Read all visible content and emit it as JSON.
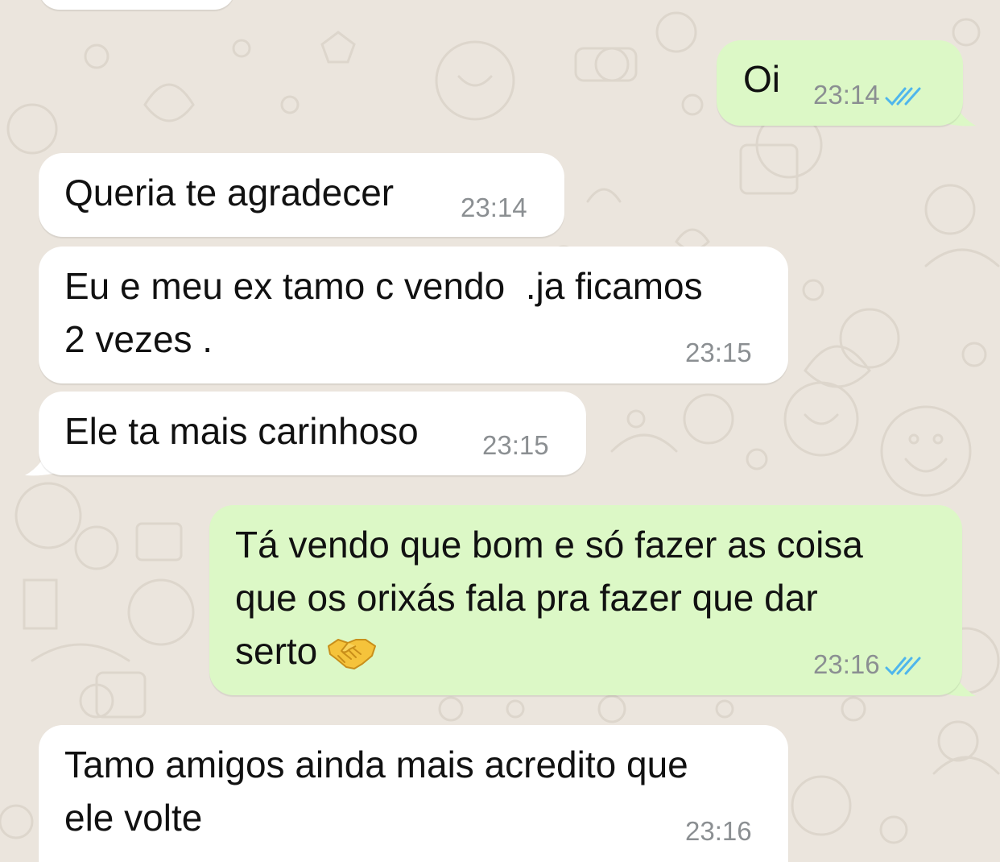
{
  "chat": {
    "accent_read_ticks": "#4fb6ec",
    "incoming_color": "#ffffff",
    "outgoing_color": "#dcf8c6",
    "messages": [
      {
        "direction": "outgoing",
        "text": "Oi",
        "time": "23:14",
        "status": "read"
      },
      {
        "direction": "incoming",
        "text": "Queria te agradecer",
        "time": "23:14"
      },
      {
        "direction": "incoming",
        "text_lines": [
          "Eu e meu ex tamo c vendo  .ja ficamos",
          "2 vezes ."
        ],
        "time": "23:15"
      },
      {
        "direction": "incoming",
        "text": "Ele ta mais carinhoso",
        "time": "23:15"
      },
      {
        "direction": "outgoing",
        "text_lines": [
          "Tá vendo que bom e só fazer as coisa",
          "que os orixás fala pra fazer que dar",
          "serto"
        ],
        "emoji": "handshake-emoji",
        "time": "23:16",
        "status": "read"
      },
      {
        "direction": "incoming",
        "text_lines": [
          "Tamo amigos ainda mais acredito que",
          "ele volte"
        ],
        "time": "23:16"
      }
    ]
  }
}
